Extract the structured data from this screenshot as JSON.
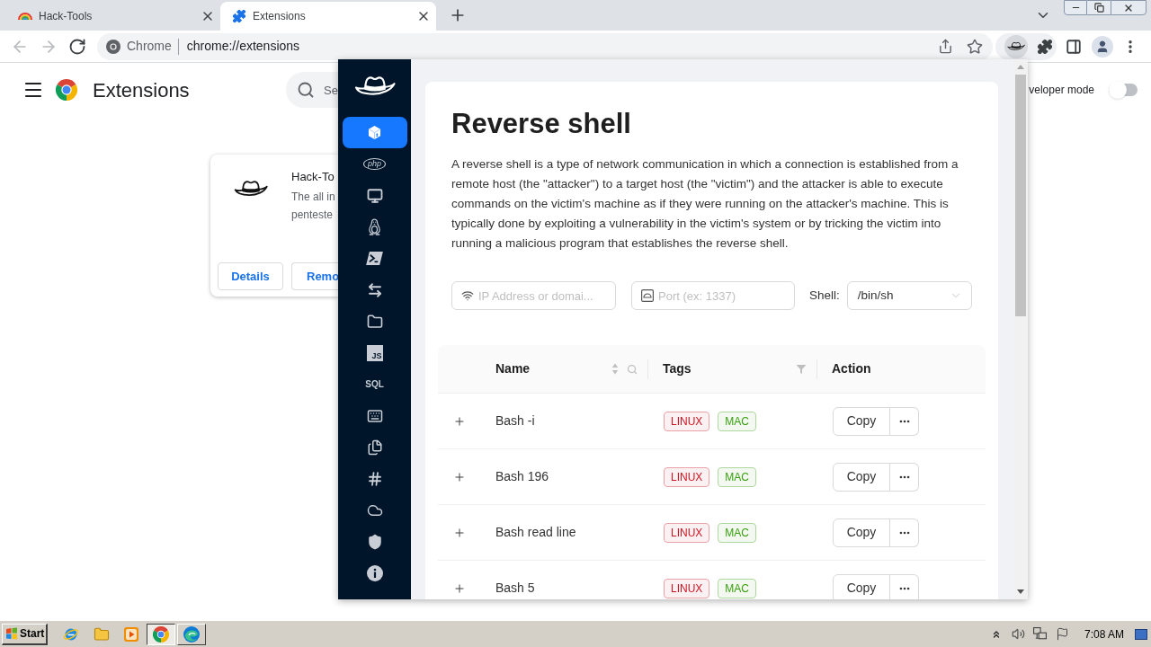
{
  "browser": {
    "tabs": [
      {
        "title": "Hack-Tools",
        "kind": "rainbow",
        "selected": false
      },
      {
        "title": "Extensions",
        "kind": "puzzle",
        "selected": true
      }
    ],
    "address_bar": {
      "label": "Chrome",
      "url": "chrome://extensions"
    }
  },
  "extensions_page": {
    "title": "Extensions",
    "search": {
      "placeholder": "Se"
    },
    "developer_mode": {
      "label": "veloper mode",
      "on": false
    },
    "card": {
      "name": "Hack-To",
      "description_lines": [
        "The all in",
        "penteste"
      ],
      "buttons": [
        "Details",
        "Remo"
      ]
    }
  },
  "popup": {
    "sidebar": [
      {
        "kind": "shell",
        "selected": true
      },
      {
        "kind": "php",
        "text": "php",
        "selected": false
      },
      {
        "kind": "monitor",
        "selected": false
      },
      {
        "kind": "linux",
        "selected": false
      },
      {
        "kind": "powershell",
        "selected": false
      },
      {
        "kind": "transfer",
        "selected": false
      },
      {
        "kind": "folder",
        "selected": false
      },
      {
        "kind": "js",
        "text": "JS",
        "selected": false
      },
      {
        "kind": "sql",
        "text": "SQL",
        "selected": false
      },
      {
        "kind": "keyboard",
        "selected": false
      },
      {
        "kind": "files",
        "selected": false
      },
      {
        "kind": "hash",
        "selected": false
      },
      {
        "kind": "cloud",
        "selected": false
      },
      {
        "kind": "shield",
        "selected": false
      },
      {
        "kind": "info",
        "selected": false
      }
    ],
    "title": "Reverse shell",
    "description": "A reverse shell is a type of network communication in which a connection is established from a remote host (the \"attacker\") to a target host (the \"victim\") and the attacker is able to execute commands on the victim's machine as if they were running on the attacker's machine. This is typically done by exploiting a vulnerability in the victim's system or by tricking the victim into running a malicious program that establishes the reverse shell.",
    "ip_field": {
      "placeholder": "IP Address or domai..."
    },
    "port_field": {
      "placeholder": "Port (ex: 1337)"
    },
    "shell": {
      "label": "Shell:",
      "value": "/bin/sh"
    },
    "table": {
      "columns": [
        {
          "title": "Name",
          "sorter": true,
          "search": true
        },
        {
          "title": "Tags",
          "filter": true
        },
        {
          "title": "Action"
        }
      ],
      "rows": [
        {
          "name": "Bash -i",
          "tags": [
            {
              "label": "LINUX",
              "color": "#cf1322"
            },
            {
              "label": "MAC",
              "color": "#389e0d"
            }
          ],
          "action": "Copy"
        },
        {
          "name": "Bash 196",
          "tags": [
            {
              "label": "LINUX",
              "color": "#cf1322"
            },
            {
              "label": "MAC",
              "color": "#389e0d"
            }
          ],
          "action": "Copy"
        },
        {
          "name": "Bash read line",
          "tags": [
            {
              "label": "LINUX",
              "color": "#cf1322"
            },
            {
              "label": "MAC",
              "color": "#389e0d"
            }
          ],
          "action": "Copy"
        },
        {
          "name": "Bash 5",
          "tags": [
            {
              "label": "LINUX",
              "color": "#cf1322"
            },
            {
              "label": "MAC",
              "color": "#389e0d"
            }
          ],
          "action": "Copy"
        }
      ]
    }
  },
  "taskbar": {
    "start": "Start",
    "quick_launch": [
      {
        "kind": "ie"
      },
      {
        "kind": "explorer"
      },
      {
        "kind": "media"
      }
    ],
    "windows": [
      {
        "kind": "chrome",
        "selected": true
      },
      {
        "kind": "edge",
        "selected": false
      }
    ],
    "clock": "7:08 AM"
  }
}
